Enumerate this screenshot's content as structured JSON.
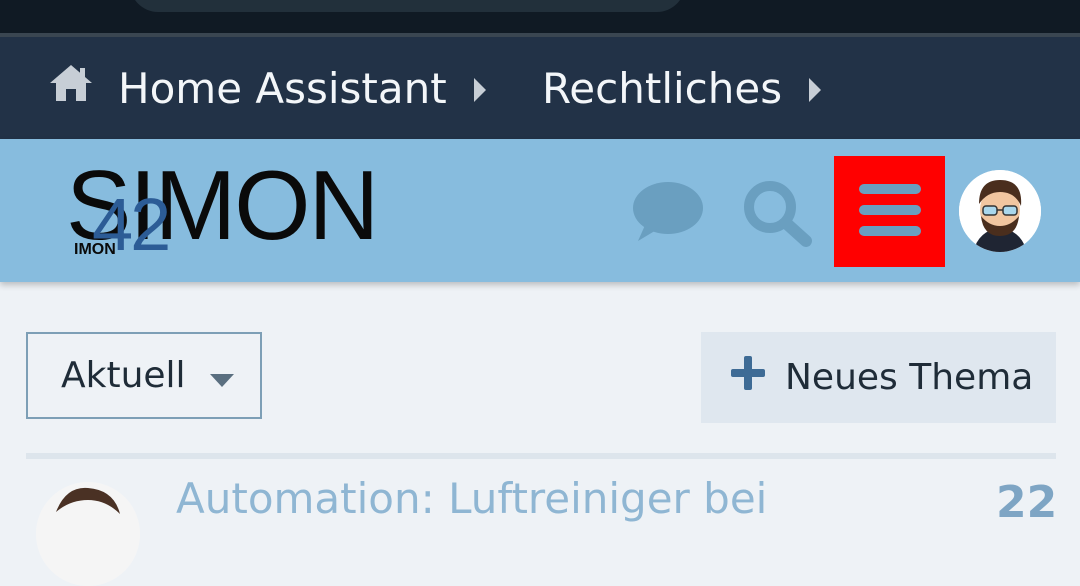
{
  "breadcrumb": {
    "items": [
      {
        "label": "Home Assistant",
        "icon": "home-icon"
      },
      {
        "label": "Rechtliches"
      }
    ]
  },
  "header": {
    "logo": {
      "main": "SIMON",
      "number": "42",
      "small": "IMON"
    },
    "icons": [
      "chat-icon",
      "search-icon",
      "menu-icon",
      "avatar"
    ],
    "menu_highlight_color": "#ff0000",
    "background_color": "#87bcde"
  },
  "toolbar": {
    "filter_label": "Aktuell",
    "new_topic_label": "Neues Thema"
  },
  "topic_list": {
    "first_topic_title": "Automation: Luftreiniger bei",
    "first_topic_count": "22"
  },
  "colors": {
    "breadcrumb_bg": "#223247",
    "page_bg": "#eef2f6",
    "accent": "#2c5c96"
  }
}
